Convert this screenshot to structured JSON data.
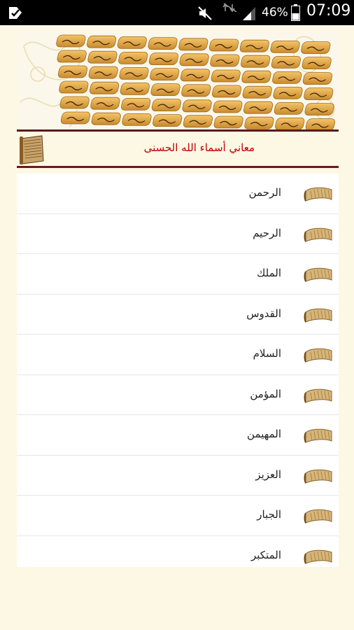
{
  "status_bar": {
    "battery_percent": "46%",
    "time": "07:09",
    "icons": [
      "notification-icon",
      "mute-icon",
      "data-off-icon",
      "signal-icon",
      "battery-icon"
    ]
  },
  "header": {
    "title": "معاني أسماء الله الحسنى"
  },
  "names_list": [
    {
      "label": "الرحمن"
    },
    {
      "label": "الرحيم"
    },
    {
      "label": "الملك"
    },
    {
      "label": "القدوس"
    },
    {
      "label": "السلام"
    },
    {
      "label": "المؤمن"
    },
    {
      "label": "المهيمن"
    },
    {
      "label": "العزيز"
    },
    {
      "label": "الجبار"
    },
    {
      "label": "المتكبر"
    }
  ],
  "colors": {
    "background": "#fdf8e4",
    "title_text": "#c00000",
    "divider": "#6b1b1b",
    "tile": "#e0a24a"
  }
}
